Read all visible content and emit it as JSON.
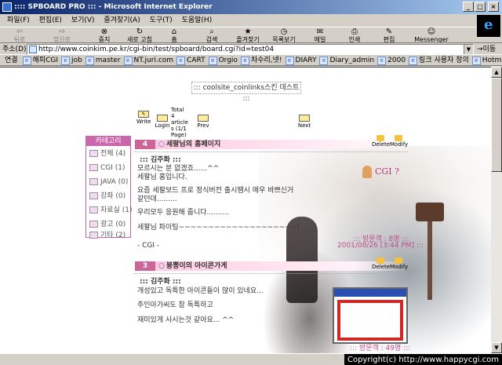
{
  "window": {
    "title": ":::: SPBOARD PRO ::: - Microsoft Internet Explorer"
  },
  "menu": [
    "파일(F)",
    "편집(E)",
    "보기(V)",
    "즐겨찾기(A)",
    "도구(T)",
    "도움말(H)"
  ],
  "toolbar": {
    "back": "뒤로",
    "forward": "앞으로",
    "stop": "중지",
    "refresh": "새로 고침",
    "home": "홈",
    "search": "검색",
    "favorites": "즐겨찾기",
    "history": "목록보기",
    "mail": "메일",
    "print": "인쇄",
    "edit": "편집",
    "messenger": "Messenger"
  },
  "address": {
    "label": "주소(D)",
    "url": "http://www.coinkim.pe.kr/cgi-bin/test/spboard/board.cgi?id=test04",
    "go": "이동"
  },
  "links": {
    "label": "연결",
    "items": [
      "해피CGI",
      "job",
      "master",
      "NT.juri.com",
      "CART",
      "Orgio",
      "차수리,넷!",
      "DIARY",
      "Diary_admin",
      "2000",
      "링크 사용자 정의",
      "Hotmail"
    ]
  },
  "page": {
    "title": "::: coolsite_coinlinks스킨 데스트 :::",
    "nav": {
      "write": "Write",
      "login": "Login",
      "total": "Total 4 articles (1/1 Page)",
      "prev": "Prev",
      "next": "Next"
    },
    "category": {
      "title": "카테고리",
      "items": [
        "전체 (4)",
        "CGI (1)",
        "JAVA (0)",
        "강좌 (0)",
        "자료실 (1)",
        "광고 (0)",
        "기타 (2)"
      ]
    },
    "posts": [
      {
        "num": "4",
        "title": "세팔님의 홈페이지",
        "author": "김주화",
        "lines": [
          "모르시는 분 없겠죠......^^",
          "세팔님 홈입니다.",
          "",
          "요즘 세팔보드 프로 정식버전 출시땜시 매우 바쁘신거",
          "같던데.........",
          "",
          "우리모두 응원해 줍니다..........",
          "",
          "세팔님 파이팅~~~~~~~~~~~~~~~~~~~~!"
        ],
        "footer": "- CGI -",
        "visits": "::: 방문객 : 8명 :::",
        "date": "2001/08/26 [3:44 PM] :::"
      },
      {
        "num": "3",
        "title": "붕뽕이의 아이콘가게",
        "author": "김주화",
        "lines": [
          "개성있고 독특한 아이콘들이 많이 있네요...",
          "",
          "주인아가씨도 참 독특하고",
          "",
          "재미있게 사시는것 같아요... ^^"
        ],
        "visits": "::: 방문객 : 49명 :::"
      }
    ],
    "delete": "Delete",
    "modify": "Modify",
    "badge": "CGI ?"
  },
  "status": {
    "copyright": "Copyright(c) http://www.happycgi.com"
  }
}
